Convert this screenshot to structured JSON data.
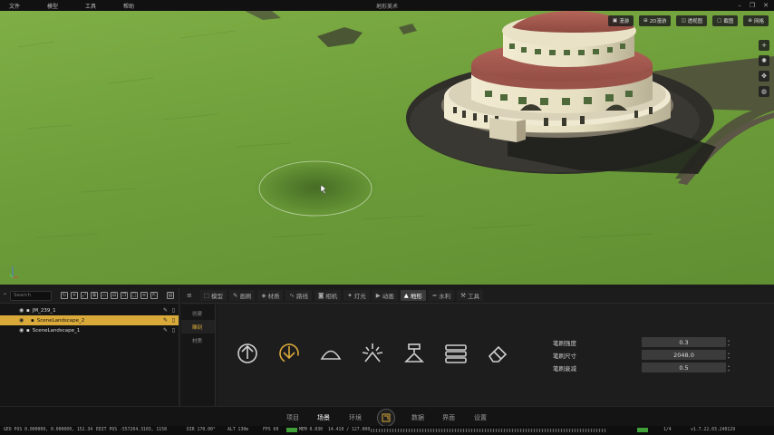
{
  "menubar": {
    "items": [
      "文件",
      "模型",
      "工具",
      "帮助"
    ],
    "title": "地形美术",
    "window_controls": [
      "minimize-icon",
      "restore-icon",
      "close-icon"
    ]
  },
  "viewport": {
    "toolbar": [
      {
        "icon": "landscape-icon",
        "label": "漫游"
      },
      {
        "icon": "grid-icon",
        "label": "2D漫游"
      },
      {
        "icon": "camera-icon",
        "label": "透视图"
      },
      {
        "icon": "screenshot-icon",
        "label": "截图"
      },
      {
        "icon": "grid-snap-icon",
        "label": "网格"
      }
    ],
    "side_buttons": [
      "plus-icon",
      "sun-icon",
      "move-icon",
      "globe-icon"
    ]
  },
  "outliner": {
    "search_placeholder": "Search",
    "toolbar_icons": [
      "refresh-icon",
      "delete-icon",
      "expand-icon",
      "copy-icon",
      "folder-icon",
      "group-icon",
      "duplicate-icon",
      "box-icon",
      "list-icon",
      "export-icon",
      "panel-icon"
    ],
    "items": [
      {
        "label": "JM_239_1",
        "selected": false,
        "indent": 0
      },
      {
        "label": "SceneLandscape_2",
        "selected": true,
        "indent": 1
      },
      {
        "label": "SceneLandscape_1",
        "selected": false,
        "indent": 1
      }
    ]
  },
  "tabs": [
    {
      "label": "模型",
      "icon": "cube-icon",
      "active": false
    },
    {
      "label": "画刷",
      "icon": "brush-icon",
      "active": false
    },
    {
      "label": "材质",
      "icon": "material-icon",
      "active": false
    },
    {
      "label": "路线",
      "icon": "path-icon",
      "active": false
    },
    {
      "label": "相机",
      "icon": "camera-icon",
      "active": false
    },
    {
      "label": "灯光",
      "icon": "light-icon",
      "active": false
    },
    {
      "label": "动画",
      "icon": "animation-icon",
      "active": false
    },
    {
      "label": "地形",
      "icon": "terrain-icon",
      "active": true
    },
    {
      "label": "水利",
      "icon": "water-icon",
      "active": false
    },
    {
      "label": "工具",
      "icon": "tool-icon",
      "active": false
    }
  ],
  "subtabs": [
    {
      "label": "创建",
      "active": false
    },
    {
      "label": "雕刻",
      "active": true
    },
    {
      "label": "材质",
      "active": false
    }
  ],
  "sculpt_tools": [
    {
      "icon": "raise-icon",
      "active": false
    },
    {
      "icon": "lower-icon",
      "active": true
    },
    {
      "icon": "smooth-icon",
      "active": false
    },
    {
      "icon": "noise-icon",
      "active": false
    },
    {
      "icon": "flatten-icon",
      "active": false
    },
    {
      "icon": "layers-icon",
      "active": false
    },
    {
      "icon": "eraser-icon",
      "active": false
    }
  ],
  "params": [
    {
      "label": "笔刷强度",
      "value": "0.3"
    },
    {
      "label": "笔刷尺寸",
      "value": "2048.0"
    },
    {
      "label": "笔刷衰减",
      "value": "0.5"
    }
  ],
  "bottom_nav": [
    {
      "label": "项目",
      "active": false
    },
    {
      "label": "场景",
      "active": true
    },
    {
      "label": "环境",
      "active": false
    },
    {
      "label": "数据",
      "active": false
    },
    {
      "label": "界面",
      "active": false
    },
    {
      "label": "设置",
      "active": false
    }
  ],
  "statusbar": {
    "geo_pos": "GEO POS  0.000000, 0.000000, 152.34",
    "edit_pos": "EDIT POS  -557204.3103, 1158",
    "dir": "DIR  170.00°",
    "alt": "ALT  130m",
    "fps": "FPS  60",
    "mem": "MEM  0.030",
    "mem_total": "14.410 / 127.000",
    "page": "1/4",
    "version": "v1.7.22.03.240129"
  },
  "colors": {
    "accent": "#d9a93a",
    "panel_bg": "#1b1b1b",
    "grass": "#6e9e3a",
    "status_ok": "#3fa03a"
  }
}
